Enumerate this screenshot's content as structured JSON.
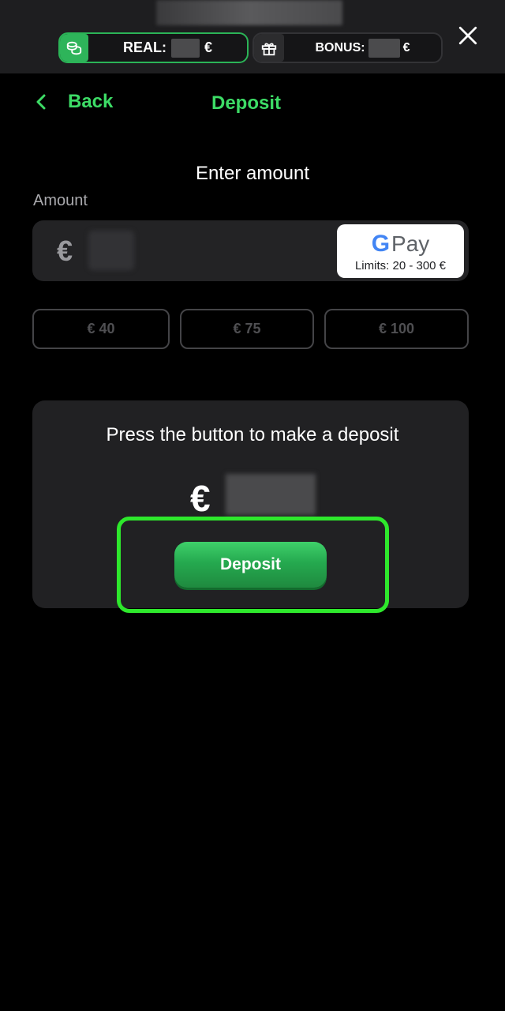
{
  "header": {
    "real": {
      "label": "REAL:",
      "currency": "€"
    },
    "bonus": {
      "label": "BONUS:",
      "currency": "€"
    }
  },
  "nav": {
    "back_label": "Back",
    "title": "Deposit"
  },
  "form": {
    "heading": "Enter amount",
    "amount_label": "Amount",
    "currency_symbol": "€",
    "payment": {
      "method": "Pay",
      "limits": "Limits: 20 - 300 €"
    },
    "quick_amounts": [
      "€ 40",
      "€ 75",
      "€ 100"
    ]
  },
  "summary": {
    "instruction": "Press the button to make a deposit",
    "currency_symbol": "€",
    "deposit_label": "Deposit"
  },
  "colors": {
    "accent": "#3ddc66",
    "highlight": "#2ee82c",
    "button": "#25a94f"
  }
}
